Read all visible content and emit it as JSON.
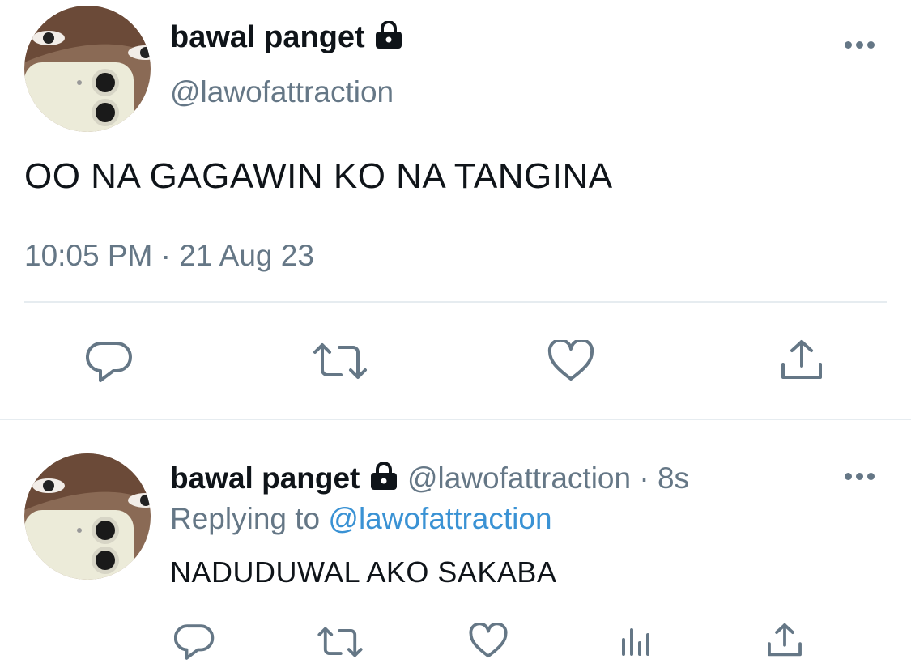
{
  "main_tweet": {
    "display_name": "bawal panget",
    "handle": "@lawofattraction",
    "text": "OO NA GAGAWIN KO NA TANGINA",
    "timestamp": "10:05 PM · 21 Aug 23",
    "icons": {
      "reply": "comment-icon",
      "retweet": "retweet-icon",
      "like": "heart-icon",
      "share": "share-icon",
      "more": "more-icon",
      "lock": "lock-icon"
    }
  },
  "reply_tweet": {
    "display_name": "bawal panget",
    "handle": "@lawofattraction",
    "time_separator": "·",
    "time_ago": "8s",
    "replying_to_label": "Replying to",
    "replying_to_handle": "@lawofattraction",
    "text": "NADUDUWAL AKO SAKABA",
    "icons": {
      "reply": "comment-icon",
      "retweet": "retweet-icon",
      "like": "heart-icon",
      "analytics": "analytics-icon",
      "share": "share-icon",
      "more": "more-icon",
      "lock": "lock-icon"
    }
  },
  "colors": {
    "text": "#0f1419",
    "muted": "#657786",
    "link": "#3a92d4",
    "divider": "#e6ecf0"
  }
}
